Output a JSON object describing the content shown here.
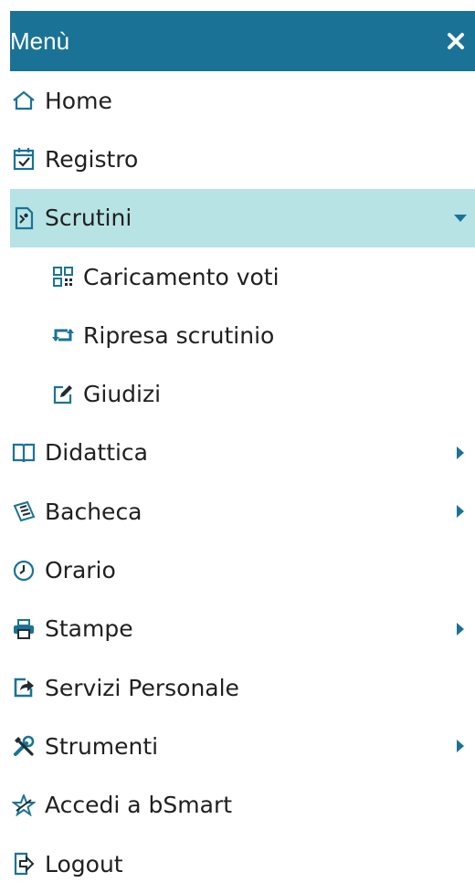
{
  "menu": {
    "title": "Menù",
    "close_icon": "close-icon",
    "items": [
      {
        "label": "Home",
        "icon": "home-icon"
      },
      {
        "label": "Registro",
        "icon": "calendar-check-icon"
      },
      {
        "label": "Scrutini",
        "icon": "scrutini-icon",
        "expanded": true
      },
      {
        "label": "Caricamento voti",
        "icon": "qrcode-icon"
      },
      {
        "label": "Ripresa scrutinio",
        "icon": "retweet-icon"
      },
      {
        "label": "Giudizi",
        "icon": "edit-icon"
      },
      {
        "label": "Didattica",
        "icon": "book-icon"
      },
      {
        "label": "Bacheca",
        "icon": "newspaper-icon"
      },
      {
        "label": "Orario",
        "icon": "clock-icon"
      },
      {
        "label": "Stampe",
        "icon": "print-icon"
      },
      {
        "label": "Servizi Personale",
        "icon": "share-icon"
      },
      {
        "label": "Strumenti",
        "icon": "tools-icon"
      },
      {
        "label": "Accedi a bSmart",
        "icon": "star-icon"
      },
      {
        "label": "Logout",
        "icon": "logout-icon"
      }
    ]
  },
  "colors": {
    "header_bg": "#1a7396",
    "active_bg": "#b7e3e5",
    "icon_primary": "#1a7396",
    "icon_dark": "#1f2d33"
  }
}
